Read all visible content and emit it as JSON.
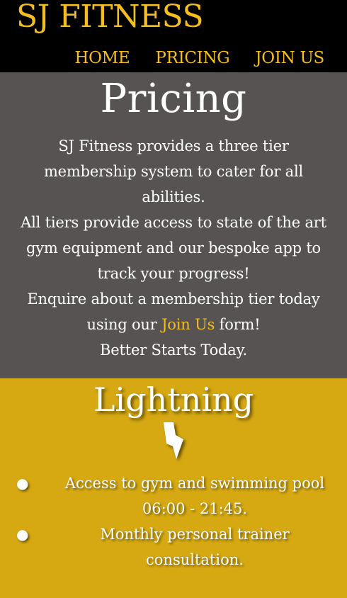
{
  "header": {
    "brand": "SJ FITNESS",
    "nav": [
      {
        "label": "HOME"
      },
      {
        "label": "PRICING"
      },
      {
        "label": "JOIN US"
      }
    ]
  },
  "pricing": {
    "title": "Pricing",
    "lines": [
      "SJ Fitness provides a three tier membership system to cater for all abilities.",
      "All tiers provide access to state of the art gym equipment and our bespoke app to track your progress!"
    ],
    "enquire_prefix": "Enquire about a membership tier today using our",
    "join_link": "Join Us",
    "enquire_suffix": "form!",
    "closing": "Better Starts Today."
  },
  "tier": {
    "name": "Lightning",
    "icon": "lightning-bolt-icon",
    "features": [
      {
        "text": "Access to gym and swimming pool",
        "detail": "06:00 - 21:45."
      },
      {
        "text": "Monthly personal trainer consultation.",
        "detail": ""
      }
    ]
  },
  "colors": {
    "accent": "#f5bd1f",
    "header_bg": "#000000",
    "pricing_bg": "#575353",
    "tier_bg": "#d6a912"
  }
}
